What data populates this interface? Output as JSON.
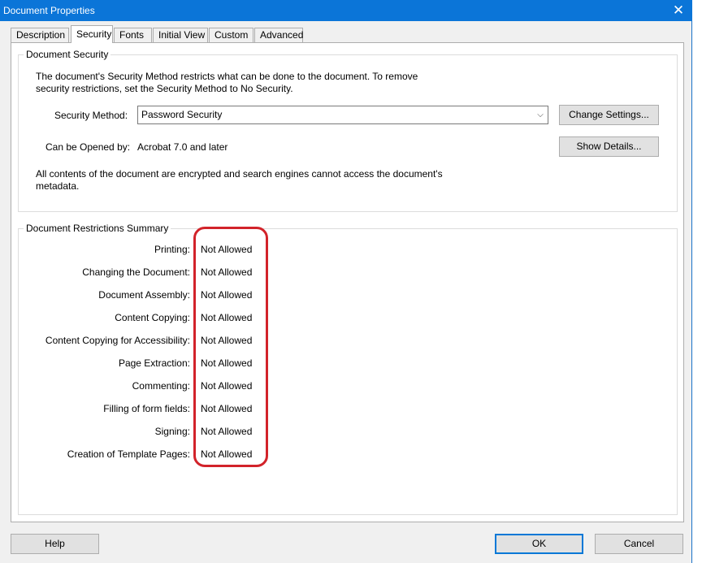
{
  "window": {
    "title": "Document Properties"
  },
  "tabs": [
    "Description",
    "Security",
    "Fonts",
    "Initial View",
    "Custom",
    "Advanced"
  ],
  "security": {
    "group_title": "Document Security",
    "intro": "The document's Security Method restricts what can be done to the document. To remove security restrictions, set the Security Method to No Security.",
    "method_label": "Security Method:",
    "method_value": "Password Security",
    "change_settings": "Change Settings...",
    "opened_by_label": "Can be Opened by:",
    "opened_by_value": "Acrobat 7.0 and later",
    "show_details": "Show Details...",
    "encryption_note": "All contents of the document are encrypted and search engines cannot access the document's metadata."
  },
  "restrictions": {
    "group_title": "Document Restrictions Summary",
    "items": [
      {
        "label": "Printing:",
        "value": "Not Allowed"
      },
      {
        "label": "Changing the Document:",
        "value": "Not Allowed"
      },
      {
        "label": "Document Assembly:",
        "value": "Not Allowed"
      },
      {
        "label": "Content Copying:",
        "value": "Not Allowed"
      },
      {
        "label": "Content Copying for Accessibility:",
        "value": "Not Allowed"
      },
      {
        "label": "Page Extraction:",
        "value": "Not Allowed"
      },
      {
        "label": "Commenting:",
        "value": "Not Allowed"
      },
      {
        "label": "Filling of form fields:",
        "value": "Not Allowed"
      },
      {
        "label": "Signing:",
        "value": "Not Allowed"
      },
      {
        "label": "Creation of Template Pages:",
        "value": "Not Allowed"
      }
    ]
  },
  "footer": {
    "help": "Help",
    "ok": "OK",
    "cancel": "Cancel"
  },
  "colors": {
    "titlebar": "#0b75d8",
    "highlight": "#d2232a",
    "default_button_border": "#0078d7"
  }
}
